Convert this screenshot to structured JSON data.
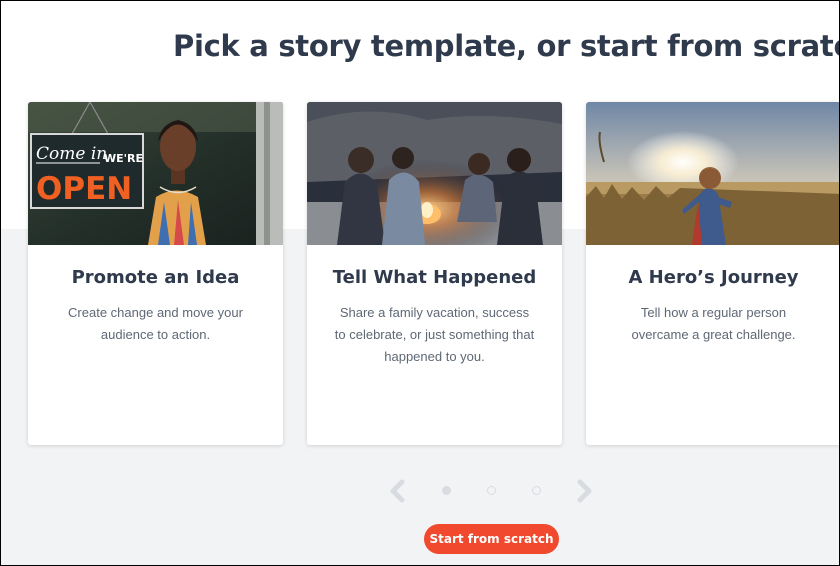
{
  "page": {
    "title": "Pick a story template, or start from scratch."
  },
  "cards": [
    {
      "title": "Promote an Idea",
      "description": "Create change and move your audience to action.",
      "sign_script": "Come in",
      "sign_small": "WE'RE",
      "sign_big": "OPEN"
    },
    {
      "title": "Tell What Happened",
      "description": "Share a family vacation, success to celebrate, or just something that happened to you."
    },
    {
      "title": "A Hero’s Journey",
      "description": "Tell how a regular person overcame a great challenge."
    }
  ],
  "carousel": {
    "prev_icon": "chevron-left-icon",
    "next_icon": "chevron-right-icon",
    "page_count": 3,
    "active_page": 1
  },
  "actions": {
    "start_from_scratch": "Start from scratch"
  },
  "colors": {
    "title": "#2f3a4c",
    "description": "#5f6875",
    "accent": "#f0492e",
    "background_lower": "#f2f3f5",
    "nav_inactive": "#d8dbe0"
  }
}
